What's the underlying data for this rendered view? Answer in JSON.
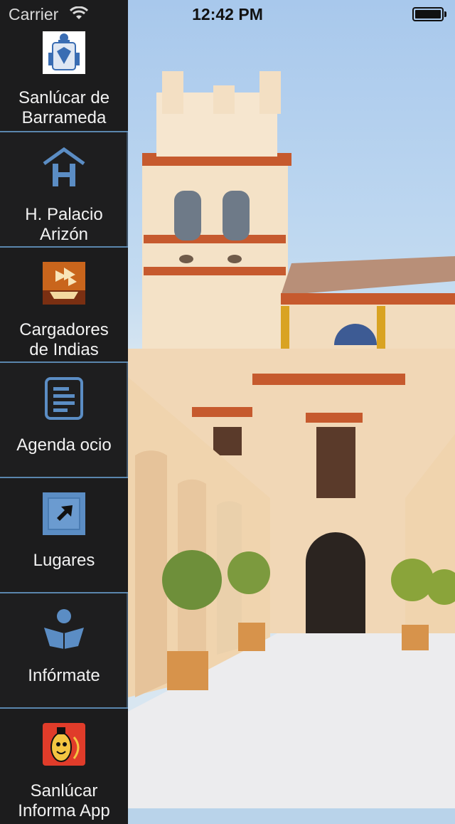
{
  "status_bar": {
    "carrier": "Carrier",
    "time": "12:42 PM"
  },
  "menu": {
    "items": [
      {
        "label_line1": "Sanlúcar de",
        "label_line2": "Barrameda",
        "icon": "coat-of-arms-icon"
      },
      {
        "label_line1": "H. Palacio",
        "label_line2": "Arizón",
        "icon": "hotel-icon"
      },
      {
        "label_line1": "Cargadores",
        "label_line2": "de Indias",
        "icon": "ship-icon"
      },
      {
        "label_line1": "Agenda ocio",
        "label_line2": "",
        "icon": "agenda-icon"
      },
      {
        "label_line1": "Lugares",
        "label_line2": "",
        "icon": "location-arrow-icon"
      },
      {
        "label_line1": "Infórmate",
        "label_line2": "",
        "icon": "reading-person-icon"
      },
      {
        "label_line1": "Sanlúcar",
        "label_line2": "Informa App",
        "icon": "app-logo-icon"
      }
    ]
  },
  "colors": {
    "menu_background": "#1e1e1f",
    "divider": "#5a86ad",
    "icon_blue": "#5b8dc4"
  }
}
